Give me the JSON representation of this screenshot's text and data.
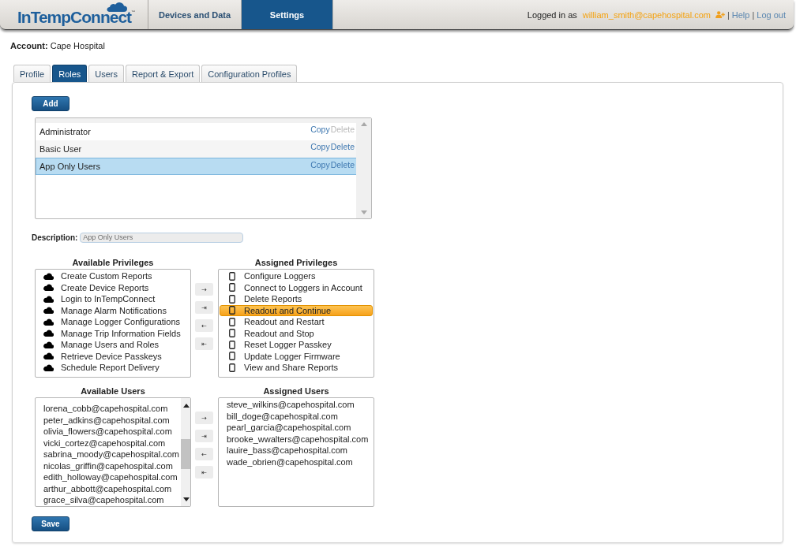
{
  "header": {
    "logo": "InTempConnect$^{™}$",
    "nav": [
      {
        "label": "Devices and Data",
        "selected": false
      },
      {
        "label": "Settings",
        "selected": true
      }
    ],
    "logged_in_label": "Logged in as",
    "user": "william_smith@capehospital.com",
    "links": [
      {
        "separator": "|",
        "label": "Help"
      },
      {
        "separator": "|",
        "label": "Log out"
      }
    ]
  },
  "account": {
    "label": "Account:",
    "value": "Cape Hospital"
  },
  "tabs": [
    {
      "label": "Profile",
      "selected": false
    },
    {
      "label": "Roles",
      "selected": true
    },
    {
      "label": "Users",
      "selected": false
    },
    {
      "label": "Report & Export",
      "selected": false
    },
    {
      "label": "Configuration Profiles",
      "selected": false
    }
  ],
  "add_button": "Add",
  "roles": [
    {
      "name": "Administrator",
      "selected": false,
      "actions": [
        {
          "label": "Copy",
          "disabled": false
        },
        {
          "label": "Delete",
          "disabled": true
        }
      ]
    },
    {
      "name": "Basic User",
      "selected": false,
      "actions": [
        {
          "label": "Copy",
          "disabled": false
        },
        {
          "label": "Delete",
          "disabled": false
        }
      ]
    },
    {
      "name": "App Only Users",
      "selected": true,
      "actions": [
        {
          "label": "Copy",
          "disabled": false
        },
        {
          "label": "Delete",
          "disabled": false
        }
      ]
    }
  ],
  "description": {
    "label": "Description:",
    "value": "App Only Users",
    "disabled": true
  },
  "privileges": {
    "available": {
      "title": "Available Privileges",
      "items": [
        {
          "label": "Create Custom Reports",
          "selected": false
        },
        {
          "label": "Create Device Reports",
          "selected": false
        },
        {
          "label": "Login to InTempConnect",
          "selected": false
        },
        {
          "label": "Manage Alarm Notifications",
          "selected": false
        },
        {
          "label": "Manage Logger Configurations",
          "selected": false
        },
        {
          "label": "Manage Trip Information Fields",
          "selected": false
        },
        {
          "label": "Manage Users and Roles",
          "selected": false
        },
        {
          "label": "Retrieve Device Passkeys",
          "selected": false
        },
        {
          "label": "Schedule Report Delivery",
          "selected": false
        }
      ]
    },
    "transfer_buttons": [
      "→",
      "⇥",
      "←",
      "⇤"
    ],
    "assigned": {
      "title": "Assigned Privileges",
      "items": [
        {
          "label": "Configure Loggers",
          "selected": false
        },
        {
          "label": "Connect to Loggers in Account",
          "selected": false
        },
        {
          "label": "Delete Reports",
          "selected": false
        },
        {
          "label": "Readout and Continue",
          "selected": true
        },
        {
          "label": "Readout and Restart",
          "selected": false
        },
        {
          "label": "Readout and Stop",
          "selected": false
        },
        {
          "label": "Reset Logger Passkey",
          "selected": false
        },
        {
          "label": "Update Logger Firmware",
          "selected": false
        },
        {
          "label": "View and Share Reports",
          "selected": false
        }
      ]
    }
  },
  "users": {
    "available": {
      "title": "Available Users",
      "items": [
        {
          "label": "lorena_cobb@capehospital.com",
          "selected": false
        },
        {
          "label": "peter_adkins@capehospital.com",
          "selected": false
        },
        {
          "label": "olivia_flowers@capehospital.com",
          "selected": false
        },
        {
          "label": "vicki_cortez@capehospital.com",
          "selected": false
        },
        {
          "label": "sabrina_moody@capehospital.com",
          "selected": false
        },
        {
          "label": "nicolas_griffin@capehospital.com",
          "selected": false
        },
        {
          "label": "edith_holloway@capehospital.com",
          "selected": false
        },
        {
          "label": "arthur_abbott@capehospital.com",
          "selected": false
        },
        {
          "label": "grace_silva@capehospital.com",
          "selected": false
        }
      ]
    },
    "transfer_buttons": [
      "→",
      "⇥",
      "←",
      "⇤"
    ],
    "assigned": {
      "title": "Assigned Users",
      "items": [
        {
          "label": "steve_wilkins@capehospital.com",
          "selected": false
        },
        {
          "label": "bill_doge@capehospital.com",
          "selected": false
        },
        {
          "label": "pearl_garcia@capehospital.com",
          "selected": false
        },
        {
          "label": "brooke_wwalters@capehospital.com",
          "selected": false
        },
        {
          "label": "lauire_bass@capehospital.com",
          "selected": false
        },
        {
          "label": "wade_obrien@capehospital.com",
          "selected": false
        }
      ]
    }
  },
  "save_button": "Save"
}
